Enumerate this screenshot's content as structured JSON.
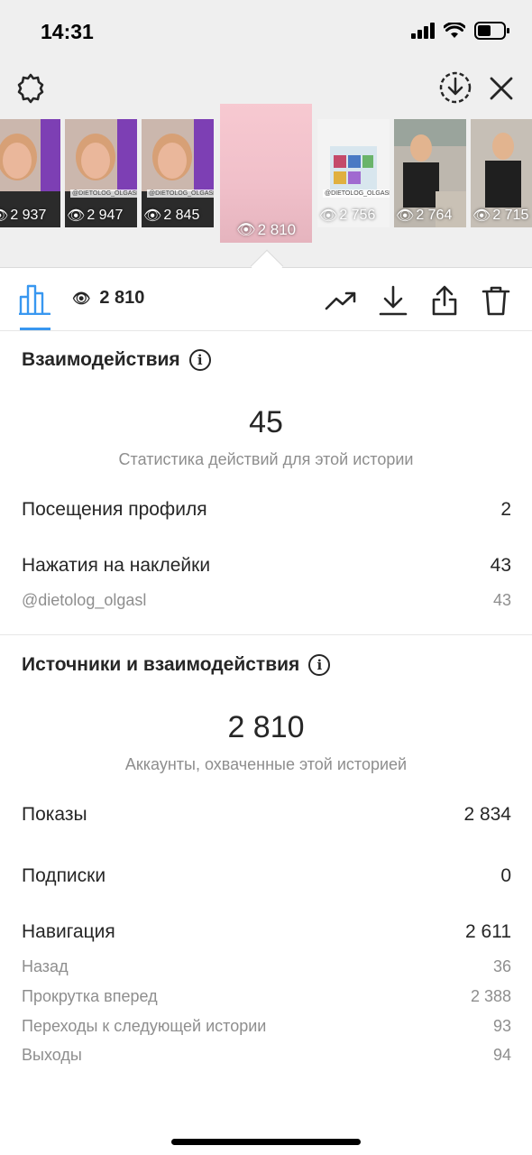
{
  "status_bar": {
    "time": "14:31"
  },
  "header": {
    "settings_icon": "gear-icon",
    "download_icon": "download-circle-icon",
    "close_icon": "close-icon"
  },
  "stories": [
    {
      "views": "2 937",
      "tag": ""
    },
    {
      "views": "2 947",
      "tag": "@DIETOLOG_OLGASL"
    },
    {
      "views": "2 845",
      "tag": "@DIETOLOG_OLGASL"
    },
    {
      "views": "2 810",
      "tag": "",
      "selected": true
    },
    {
      "views": "2 756",
      "tag": "@DIETOLOG_OLGASL"
    },
    {
      "views": "2 764",
      "tag": ""
    },
    {
      "views": "2 715",
      "tag": ""
    }
  ],
  "toolbar": {
    "views": "2 810"
  },
  "interactions": {
    "title": "Взаимодействия",
    "total": "45",
    "caption": "Статистика действий для этой истории",
    "rows": [
      {
        "label": "Посещения профиля",
        "value": "2"
      },
      {
        "label": "Нажатия на наклейки",
        "value": "43"
      },
      {
        "label": "@dietolog_olgasl",
        "value": "43"
      }
    ]
  },
  "discovery": {
    "title": "Источники и взаимодействия",
    "total": "2 810",
    "caption": "Аккаунты, охваченные этой историей",
    "rows": [
      {
        "label": "Показы",
        "value": "2 834"
      },
      {
        "label": "Подписки",
        "value": "0"
      },
      {
        "label": "Навигация",
        "value": "2 611"
      },
      {
        "label": "Назад",
        "value": "36"
      },
      {
        "label": "Прокрутка вперед",
        "value": "2 388"
      },
      {
        "label": "Переходы к следующей истории",
        "value": "93"
      },
      {
        "label": "Выходы",
        "value": "94"
      }
    ]
  },
  "colors": {
    "accent": "#3897f0",
    "text": "#262626",
    "secondary": "#8e8e8e"
  }
}
